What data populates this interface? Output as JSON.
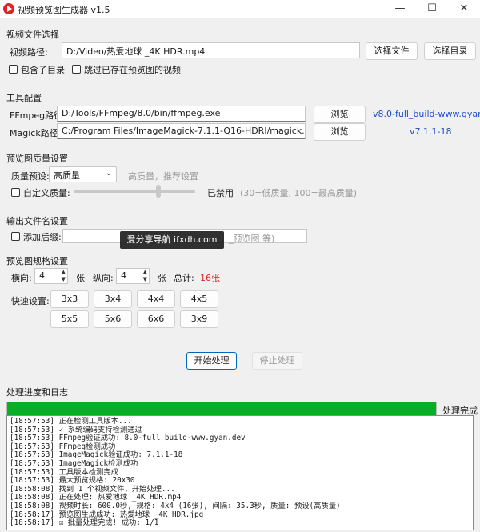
{
  "window": {
    "title": "视频预览图生成器 v1.5",
    "controls": [
      "—",
      "☐",
      "✕"
    ]
  },
  "video_source": {
    "section": "视频文件选择",
    "path_label": "视频路径:",
    "path_value": "D:/Video/热爱地球 _4K HDR.mp4",
    "select_file": "选择文件",
    "select_dir": "选择目录",
    "include_subdirs": "包含子目录",
    "skip_existing": "跳过已存在预览图的视频"
  },
  "tools": {
    "section": "工具配置",
    "ffmpeg_label": "FFmpeg路径:",
    "ffmpeg_path": "D:/Tools/FFmpeg/8.0/bin/ffmpeg.exe",
    "ffmpeg_browse": "浏览",
    "ffmpeg_version": "v8.0-full_build-www.gyan.dev",
    "magick_label": "Magick路径:",
    "magick_path": "C:/Program Files/ImageMagick-7.1.1-Q16-HDRI/magick.exe",
    "magick_browse": "浏览",
    "magick_version": "v7.1.1-18"
  },
  "quality": {
    "section": "预览图质量设置",
    "preset_label": "质量预设:",
    "preset_value": "高质量",
    "preset_hint": "高质量，推荐设置",
    "custom_label": "自定义质量:",
    "slider_value": 0.7,
    "disabled_text": "已禁用",
    "range_hint": "(30=低质量, 100=最高质量)"
  },
  "output": {
    "section": "输出文件名设置",
    "suffix_label": "添加后缀:",
    "suffix_hint": "_预览图 等)"
  },
  "grid": {
    "section": "预览图规格设置",
    "horizontal_label": "横向:",
    "horizontal_value": "4",
    "unit1": "张",
    "vertical_label": "纵向:",
    "vertical_value": "4",
    "unit2": "张",
    "total_label": "总计:",
    "total_value": "16张",
    "quick_label": "快速设置:",
    "presets": [
      "3x3",
      "3x4",
      "4x4",
      "4x5",
      "5x5",
      "5x6",
      "6x6",
      "3x9"
    ]
  },
  "actions": {
    "start": "开始处理",
    "stop": "停止处理"
  },
  "progress": {
    "section": "处理进度和日志",
    "value": 1.0,
    "status": "处理完成"
  },
  "log": [
    "[18:57:53] 正在检测工具版本...",
    "[18:57:53] ✓ 系统编码支持检测通过",
    "[18:57:53] FFmpeg验证成功: 8.0-full_build-www.gyan.dev",
    "[18:57:53] FFmpeg检测成功",
    "[18:57:53] ImageMagick验证成功: 7.1.1-18",
    "[18:57:53] ImageMagick检测成功",
    "[18:57:53] 工具版本检测完成",
    "[18:57:53] 最大预览规格: 20x30",
    "[18:58:08] 找到 1 个视频文件，开始处理...",
    "[18:58:08] 正在处理: 热爱地球 _4K HDR.mp4",
    "[18:58:08] 视频时长: 600.0秒, 规格: 4x4 (16张), 间隔: 35.3秒, 质量: 预设(高质量)",
    "[18:58:17] 预览图生成成功: 热爱地球 _4K HDR.jpg",
    "[18:58:17] ☑ 批量处理完成! 成功: 1/1"
  ],
  "watermark": "爱分享导航 ifxdh.com",
  "colors": {
    "accent": "#0067c0",
    "progress": "#06b025",
    "link": "#1a4fc9",
    "total": "#e02424",
    "app_icon": "#e02424"
  }
}
